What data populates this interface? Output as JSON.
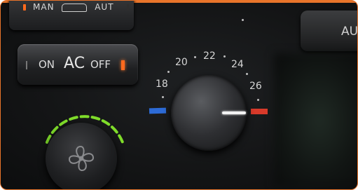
{
  "image": {
    "subject": "car-climate-control-panel"
  },
  "top_panel": {
    "label_man": "MAN",
    "label_aut": "AUT"
  },
  "ac_button": {
    "on_label": "ON",
    "ac_label": "AC",
    "off_label": "OFF"
  },
  "right_button": {
    "label": "AU"
  },
  "temperature_knob": {
    "ticks": [
      "18",
      "20",
      "22",
      "24",
      "26"
    ],
    "cold_color": "#2d6bd6",
    "hot_color": "#d83a2a"
  },
  "fan_knob": {
    "icon": "fan-icon",
    "arc_color": "#7fdc2a"
  },
  "accent": "#e8742a"
}
